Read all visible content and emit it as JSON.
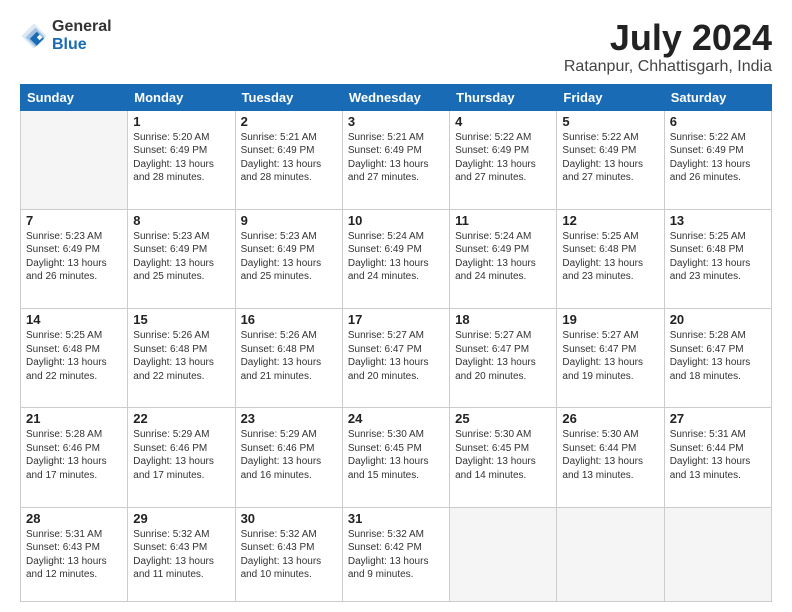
{
  "header": {
    "logo_line1": "General",
    "logo_line2": "Blue",
    "month_year": "July 2024",
    "location": "Ratanpur, Chhattisgarh, India"
  },
  "days_of_week": [
    "Sunday",
    "Monday",
    "Tuesday",
    "Wednesday",
    "Thursday",
    "Friday",
    "Saturday"
  ],
  "weeks": [
    [
      {
        "day": "",
        "empty": true
      },
      {
        "day": "1",
        "sunrise": "5:20 AM",
        "sunset": "6:49 PM",
        "daylight": "13 hours and 28 minutes."
      },
      {
        "day": "2",
        "sunrise": "5:21 AM",
        "sunset": "6:49 PM",
        "daylight": "13 hours and 28 minutes."
      },
      {
        "day": "3",
        "sunrise": "5:21 AM",
        "sunset": "6:49 PM",
        "daylight": "13 hours and 27 minutes."
      },
      {
        "day": "4",
        "sunrise": "5:22 AM",
        "sunset": "6:49 PM",
        "daylight": "13 hours and 27 minutes."
      },
      {
        "day": "5",
        "sunrise": "5:22 AM",
        "sunset": "6:49 PM",
        "daylight": "13 hours and 27 minutes."
      },
      {
        "day": "6",
        "sunrise": "5:22 AM",
        "sunset": "6:49 PM",
        "daylight": "13 hours and 26 minutes."
      }
    ],
    [
      {
        "day": "7",
        "sunrise": "5:23 AM",
        "sunset": "6:49 PM",
        "daylight": "13 hours and 26 minutes."
      },
      {
        "day": "8",
        "sunrise": "5:23 AM",
        "sunset": "6:49 PM",
        "daylight": "13 hours and 25 minutes."
      },
      {
        "day": "9",
        "sunrise": "5:23 AM",
        "sunset": "6:49 PM",
        "daylight": "13 hours and 25 minutes."
      },
      {
        "day": "10",
        "sunrise": "5:24 AM",
        "sunset": "6:49 PM",
        "daylight": "13 hours and 24 minutes."
      },
      {
        "day": "11",
        "sunrise": "5:24 AM",
        "sunset": "6:49 PM",
        "daylight": "13 hours and 24 minutes."
      },
      {
        "day": "12",
        "sunrise": "5:25 AM",
        "sunset": "6:48 PM",
        "daylight": "13 hours and 23 minutes."
      },
      {
        "day": "13",
        "sunrise": "5:25 AM",
        "sunset": "6:48 PM",
        "daylight": "13 hours and 23 minutes."
      }
    ],
    [
      {
        "day": "14",
        "sunrise": "5:25 AM",
        "sunset": "6:48 PM",
        "daylight": "13 hours and 22 minutes."
      },
      {
        "day": "15",
        "sunrise": "5:26 AM",
        "sunset": "6:48 PM",
        "daylight": "13 hours and 22 minutes."
      },
      {
        "day": "16",
        "sunrise": "5:26 AM",
        "sunset": "6:48 PM",
        "daylight": "13 hours and 21 minutes."
      },
      {
        "day": "17",
        "sunrise": "5:27 AM",
        "sunset": "6:47 PM",
        "daylight": "13 hours and 20 minutes."
      },
      {
        "day": "18",
        "sunrise": "5:27 AM",
        "sunset": "6:47 PM",
        "daylight": "13 hours and 20 minutes."
      },
      {
        "day": "19",
        "sunrise": "5:27 AM",
        "sunset": "6:47 PM",
        "daylight": "13 hours and 19 minutes."
      },
      {
        "day": "20",
        "sunrise": "5:28 AM",
        "sunset": "6:47 PM",
        "daylight": "13 hours and 18 minutes."
      }
    ],
    [
      {
        "day": "21",
        "sunrise": "5:28 AM",
        "sunset": "6:46 PM",
        "daylight": "13 hours and 17 minutes."
      },
      {
        "day": "22",
        "sunrise": "5:29 AM",
        "sunset": "6:46 PM",
        "daylight": "13 hours and 17 minutes."
      },
      {
        "day": "23",
        "sunrise": "5:29 AM",
        "sunset": "6:46 PM",
        "daylight": "13 hours and 16 minutes."
      },
      {
        "day": "24",
        "sunrise": "5:30 AM",
        "sunset": "6:45 PM",
        "daylight": "13 hours and 15 minutes."
      },
      {
        "day": "25",
        "sunrise": "5:30 AM",
        "sunset": "6:45 PM",
        "daylight": "13 hours and 14 minutes."
      },
      {
        "day": "26",
        "sunrise": "5:30 AM",
        "sunset": "6:44 PM",
        "daylight": "13 hours and 13 minutes."
      },
      {
        "day": "27",
        "sunrise": "5:31 AM",
        "sunset": "6:44 PM",
        "daylight": "13 hours and 13 minutes."
      }
    ],
    [
      {
        "day": "28",
        "sunrise": "5:31 AM",
        "sunset": "6:43 PM",
        "daylight": "13 hours and 12 minutes."
      },
      {
        "day": "29",
        "sunrise": "5:32 AM",
        "sunset": "6:43 PM",
        "daylight": "13 hours and 11 minutes."
      },
      {
        "day": "30",
        "sunrise": "5:32 AM",
        "sunset": "6:43 PM",
        "daylight": "13 hours and 10 minutes."
      },
      {
        "day": "31",
        "sunrise": "5:32 AM",
        "sunset": "6:42 PM",
        "daylight": "13 hours and 9 minutes."
      },
      {
        "day": "",
        "empty": true
      },
      {
        "day": "",
        "empty": true
      },
      {
        "day": "",
        "empty": true
      }
    ]
  ]
}
